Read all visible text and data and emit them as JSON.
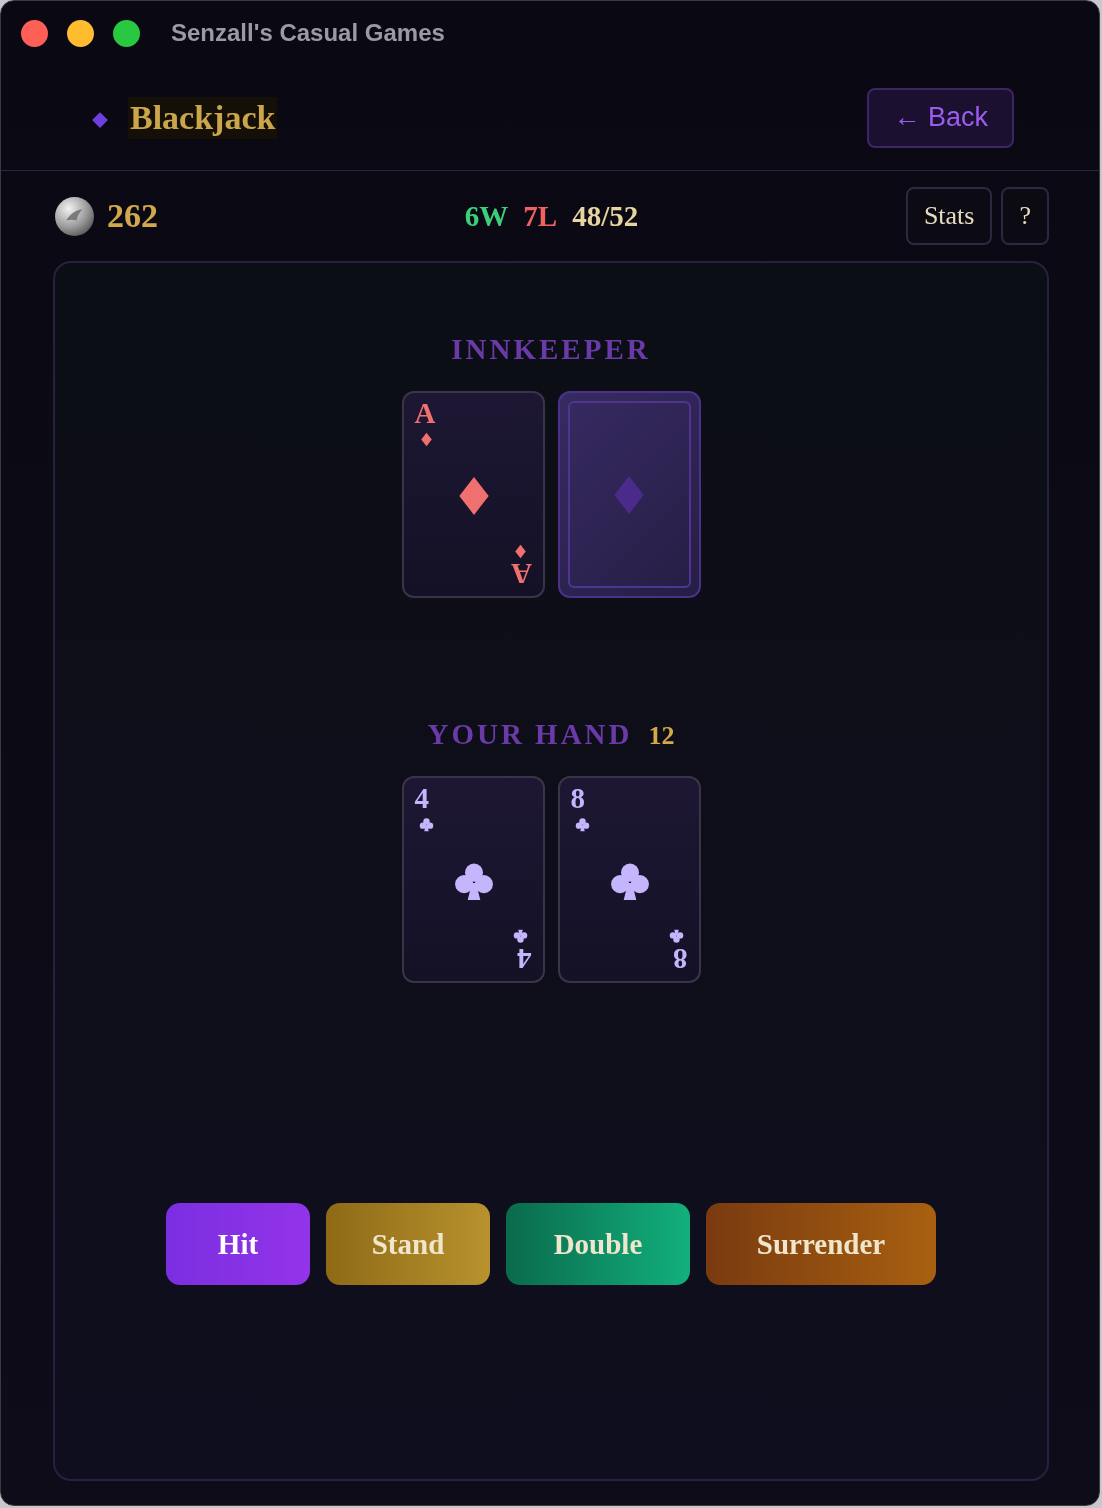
{
  "window": {
    "title": "Senzall's Casual Games"
  },
  "header": {
    "title": "Blackjack",
    "back_button": "← Back"
  },
  "status": {
    "coins": "262",
    "wins": "6W",
    "losses": "7L",
    "deck": "48/52",
    "buttons": [
      "Stats",
      "?"
    ]
  },
  "dealer": {
    "label": "INNKEEPER",
    "cards": [
      {
        "face_up": true,
        "rank": "A",
        "rank_flipped": "A",
        "kind": "diamond"
      },
      {
        "face_up": false
      }
    ]
  },
  "player": {
    "label": "YOUR HAND",
    "total": "12",
    "cards": [
      {
        "face_up": true,
        "rank": "4",
        "rank_flipped": "4",
        "kind": "club"
      },
      {
        "face_up": true,
        "rank": "8",
        "rank_flipped": "8",
        "kind": "club"
      }
    ]
  },
  "actions": [
    {
      "kind": "hit",
      "label": "Hit"
    },
    {
      "kind": "stand",
      "label": "Stand"
    },
    {
      "kind": "double",
      "label": "Double"
    },
    {
      "kind": "surrender",
      "label": "Surrender"
    }
  ]
}
